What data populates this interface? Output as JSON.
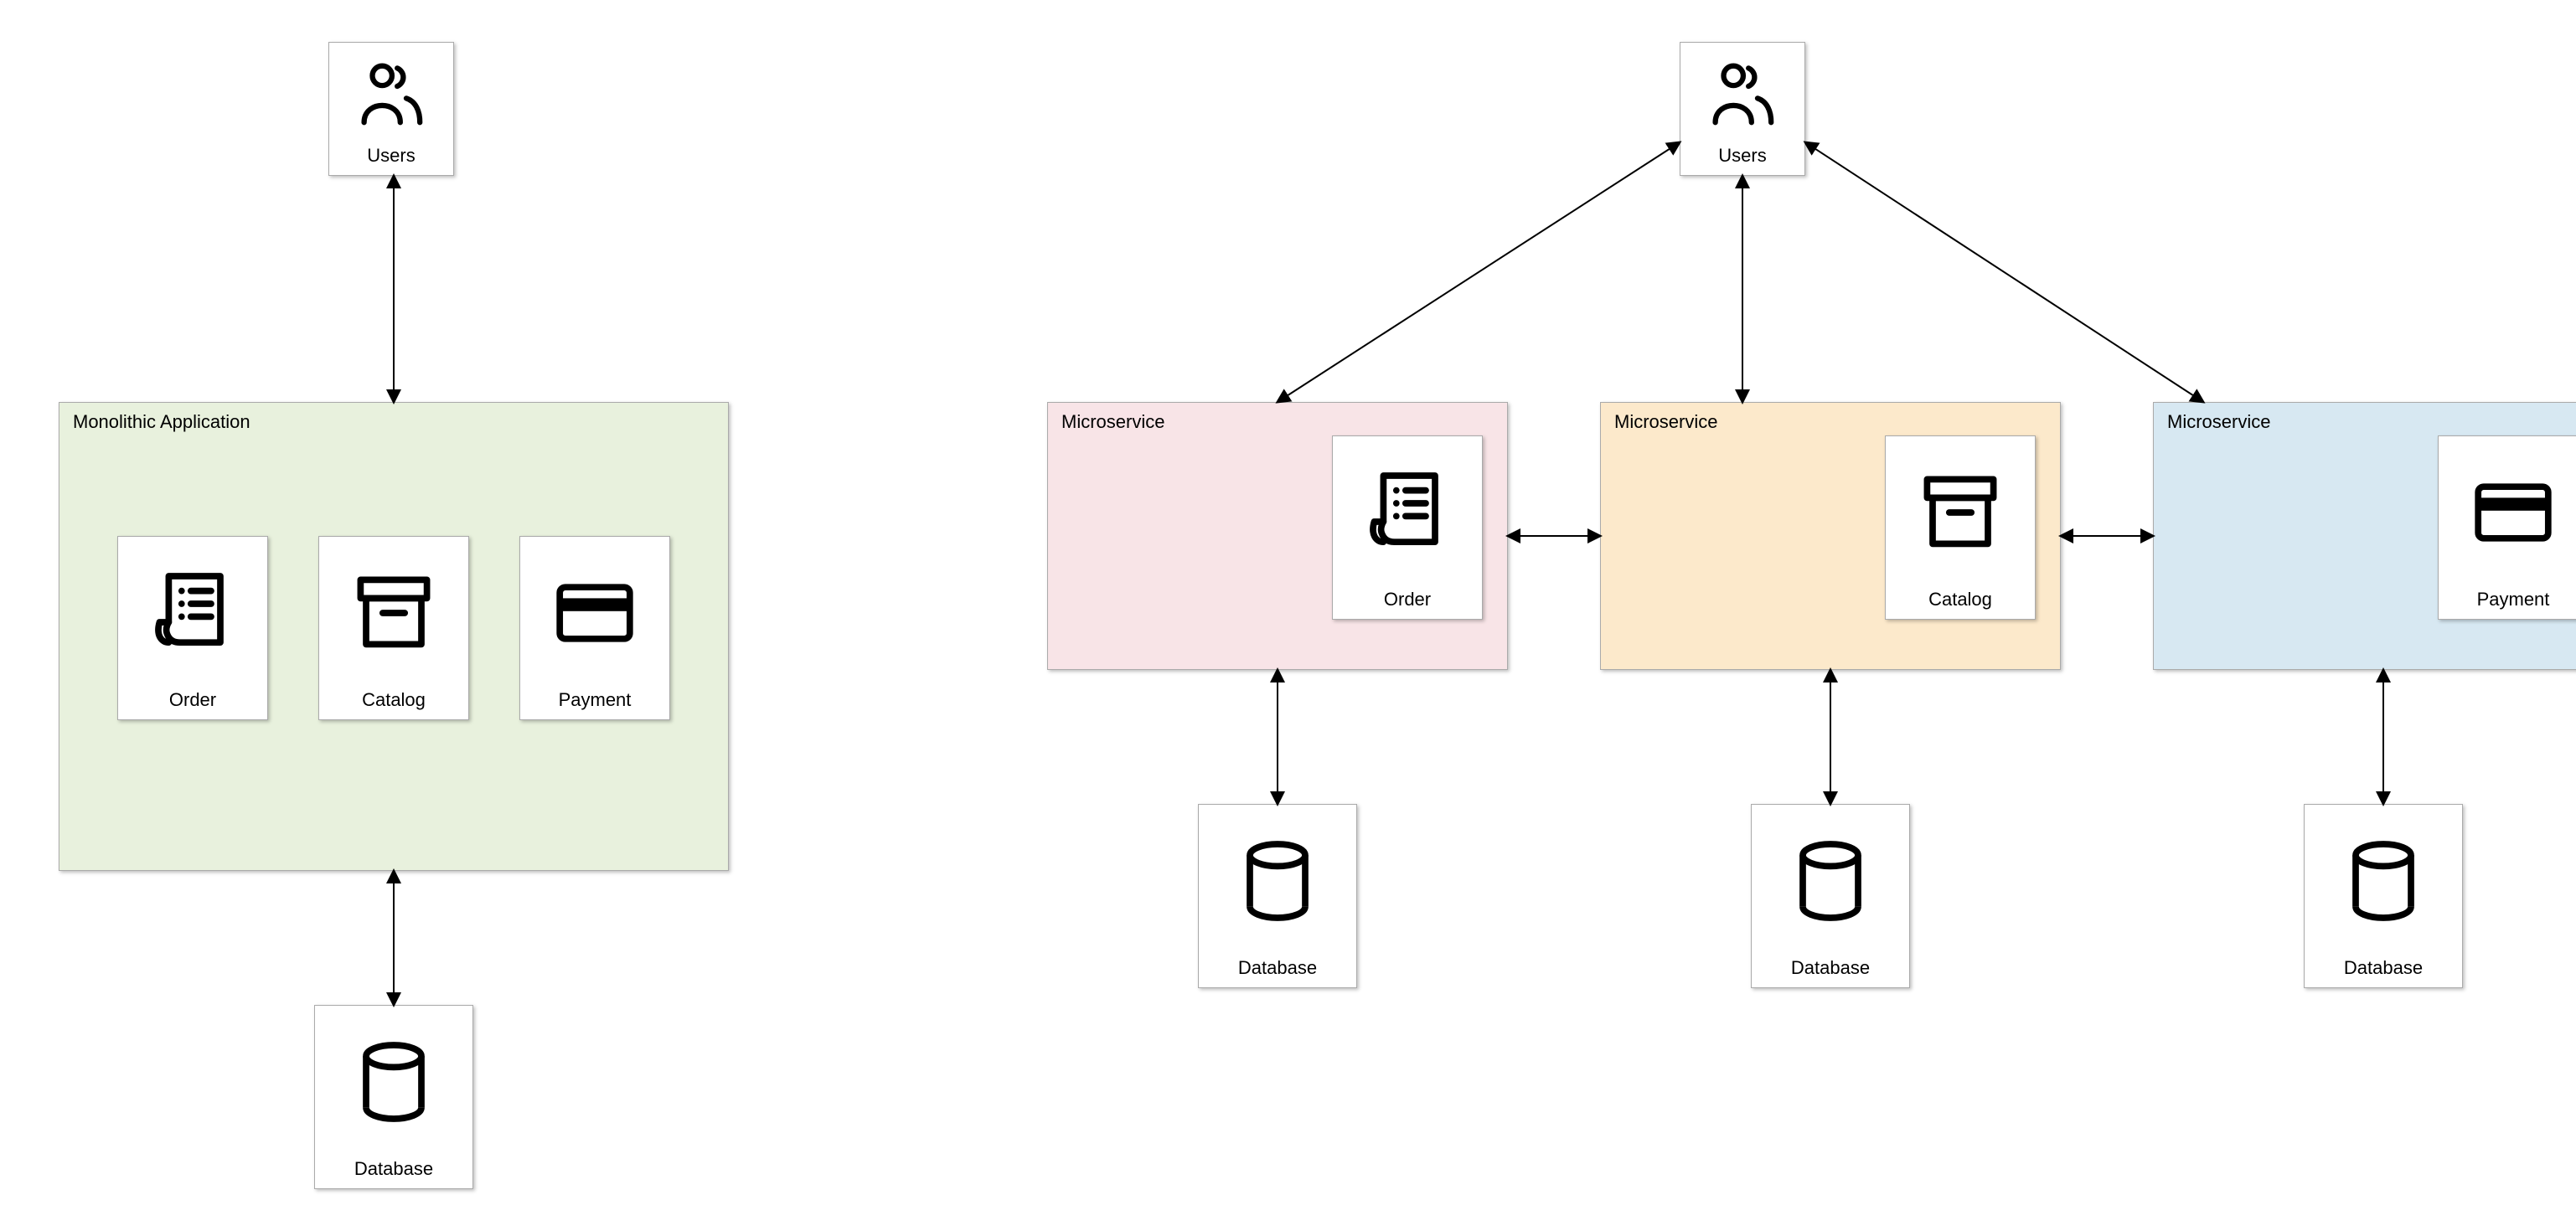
{
  "labels": {
    "users": "Users",
    "monolith_container": "Monolithic Application",
    "order": "Order",
    "catalog": "Catalog",
    "payment": "Payment",
    "database": "Database",
    "microservice": "Microservice"
  },
  "colors": {
    "monolith_bg": "#e8f1dd",
    "ms_order_bg": "#f8e4e7",
    "ms_catalog_bg": "#fce9cb",
    "ms_payment_bg": "#d7e8f2"
  },
  "diagram": {
    "left": {
      "architecture": "monolith",
      "users": true,
      "services": [
        "Order",
        "Catalog",
        "Payment"
      ],
      "databases": 1,
      "edges": [
        {
          "from": "Monolithic Application",
          "to": "Users",
          "bidirectional": true
        },
        {
          "from": "Database",
          "to": "Monolithic Application",
          "bidirectional": true
        }
      ]
    },
    "right": {
      "architecture": "microservices",
      "users": true,
      "services": [
        {
          "name": "Order",
          "container": "Microservice",
          "db": true
        },
        {
          "name": "Catalog",
          "container": "Microservice",
          "db": true
        },
        {
          "name": "Payment",
          "container": "Microservice",
          "db": true
        }
      ],
      "edges": [
        {
          "from": "Order",
          "to": "Users",
          "bidirectional": true
        },
        {
          "from": "Catalog",
          "to": "Users",
          "bidirectional": true
        },
        {
          "from": "Payment",
          "to": "Users",
          "bidirectional": true
        },
        {
          "from": "Order",
          "to": "Catalog",
          "bidirectional": true
        },
        {
          "from": "Catalog",
          "to": "Payment",
          "bidirectional": true
        },
        {
          "from": "Database",
          "to": "Order",
          "bidirectional": true
        },
        {
          "from": "Database",
          "to": "Catalog",
          "bidirectional": true
        },
        {
          "from": "Database",
          "to": "Payment",
          "bidirectional": true
        }
      ]
    }
  }
}
